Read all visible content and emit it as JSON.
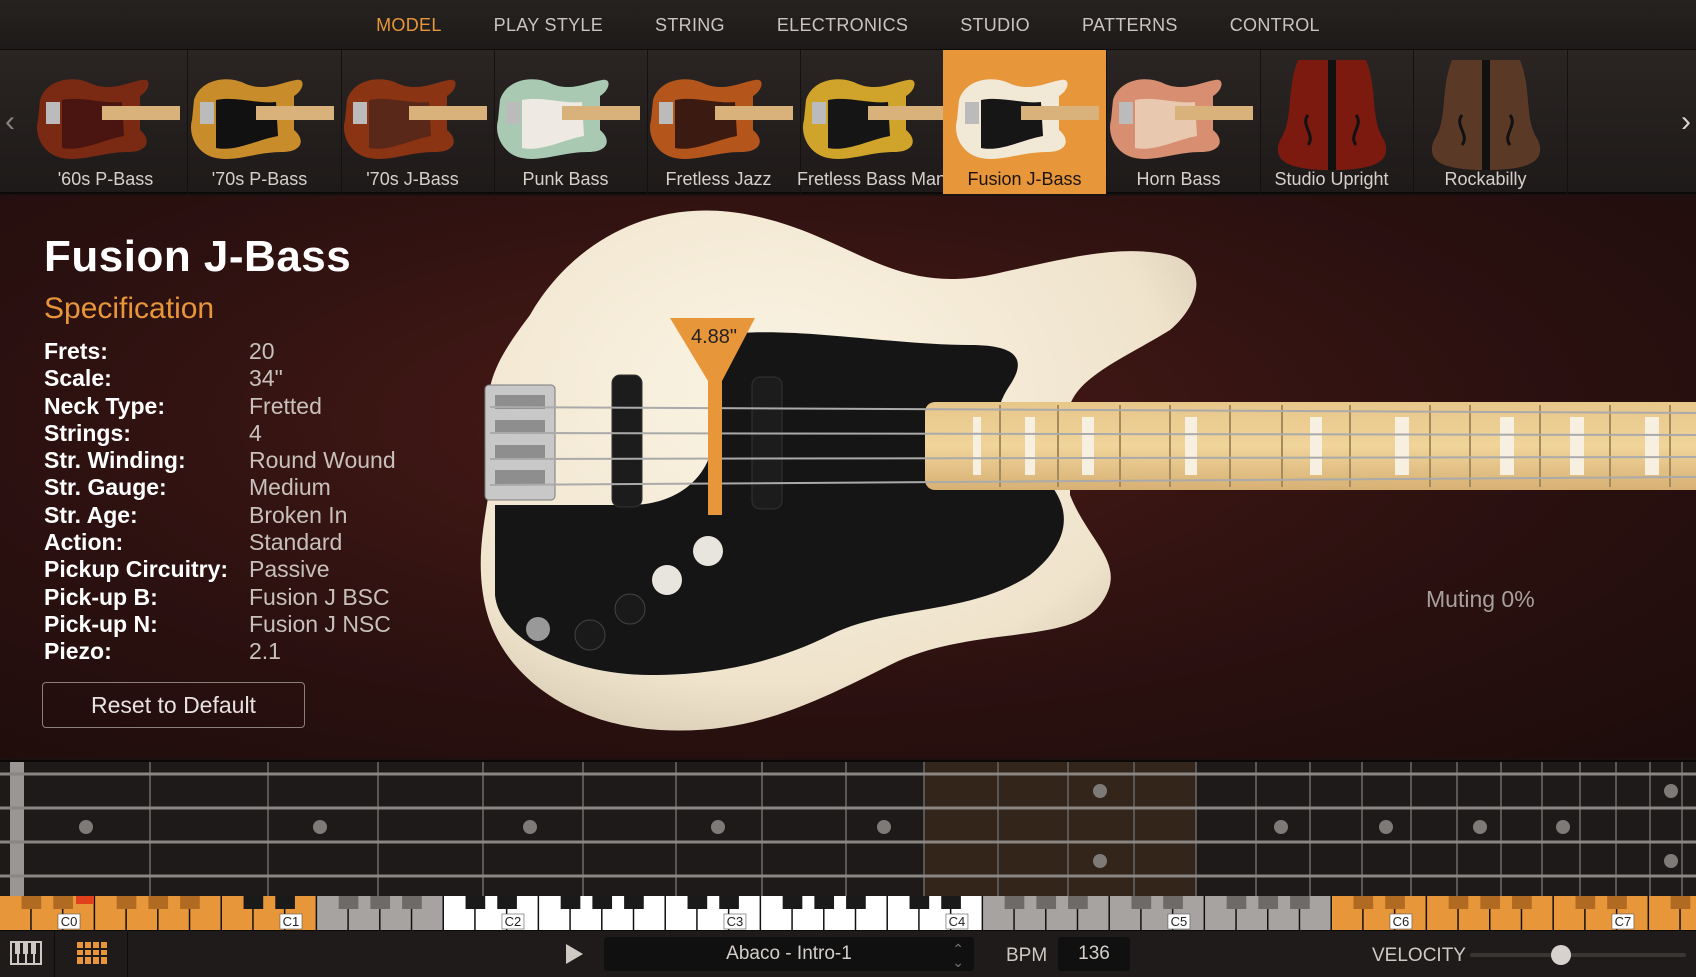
{
  "nav": {
    "tabs": [
      {
        "label": "MODEL",
        "active": true
      },
      {
        "label": "PLAY STYLE",
        "active": false
      },
      {
        "label": "STRING",
        "active": false
      },
      {
        "label": "ELECTRONICS",
        "active": false
      },
      {
        "label": "STUDIO",
        "active": false
      },
      {
        "label": "PATTERNS",
        "active": false
      },
      {
        "label": "CONTROL",
        "active": false
      }
    ]
  },
  "models": [
    {
      "name": "'60s P-Bass",
      "color": "#7a2a12",
      "pick": "#4a1410",
      "active": false
    },
    {
      "name": "'70s P-Bass",
      "color": "#c98c2a",
      "pick": "#111111",
      "active": false
    },
    {
      "name": "'70s J-Bass",
      "color": "#8a3414",
      "pick": "#5a2818",
      "active": false
    },
    {
      "name": "Punk Bass",
      "color": "#a9c9b2",
      "pick": "#efe9e3",
      "active": false
    },
    {
      "name": "Fretless Jazz",
      "color": "#b4561c",
      "pick": "#3b1a12",
      "active": false
    },
    {
      "name": "Fretless Bass Man",
      "color": "#d0a42a",
      "pick": "#151515",
      "active": false
    },
    {
      "name": "Fusion J-Bass",
      "color": "#f1e8d6",
      "pick": "#161616",
      "active": true
    },
    {
      "name": "Horn Bass",
      "color": "#d88e70",
      "pick": "#e9c8b0",
      "active": false
    },
    {
      "name": "Studio Upright",
      "color": "#7d1a10",
      "pick": "#3a0c08",
      "active": false
    },
    {
      "name": "Rockabilly",
      "color": "#5a3a26",
      "pick": "#2a1a12",
      "active": false
    }
  ],
  "detail": {
    "title": "Fusion J-Bass",
    "spec_heading": "Specification",
    "specs": [
      {
        "key": "Frets:",
        "value": "20"
      },
      {
        "key": "Scale:",
        "value": "34\""
      },
      {
        "key": "Neck Type:",
        "value": "Fretted"
      },
      {
        "key": "Strings:",
        "value": "4"
      },
      {
        "key": "Str. Winding:",
        "value": "Round Wound"
      },
      {
        "key": "Str. Gauge:",
        "value": "Medium"
      },
      {
        "key": "Str. Age:",
        "value": "Broken In"
      },
      {
        "key": "Action:",
        "value": "Standard"
      },
      {
        "key": "Pickup Circuitry:",
        "value": "Passive"
      },
      {
        "key": "Pick-up B:",
        "value": "Fusion J BSC"
      },
      {
        "key": "Pick-up N:",
        "value": "Fusion J NSC"
      },
      {
        "key": "Piezo:",
        "value": "2.1"
      }
    ],
    "reset_label": "Reset to Default",
    "pluck_position": "4.88\"",
    "muting": "Muting 0%"
  },
  "keyboard": {
    "octave_labels": [
      "C0",
      "C1",
      "C2",
      "C3",
      "C4",
      "C5",
      "C6",
      "C7"
    ]
  },
  "transport": {
    "pattern": "Abaco - Intro-1",
    "bpm_label": "BPM",
    "bpm": "136",
    "velocity_label": "VELOCITY",
    "velocity_level": 0.42
  },
  "colors": {
    "accent": "#e8963a",
    "body_cream": "#f1e8d6"
  }
}
